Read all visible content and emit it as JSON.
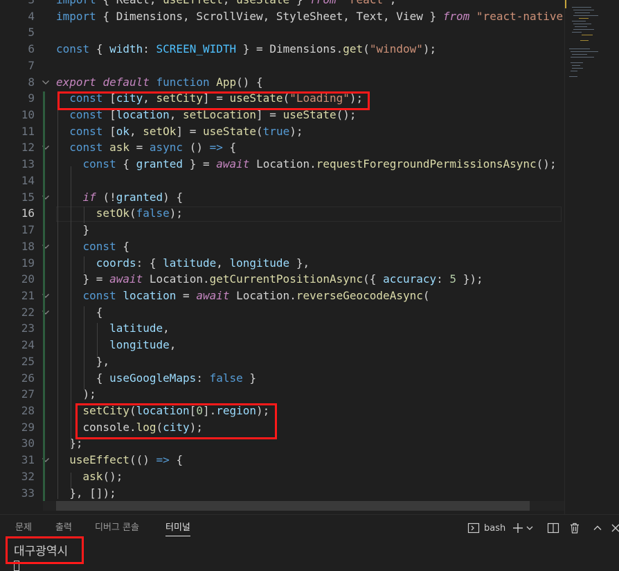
{
  "editor": {
    "line_numbers": [
      "3",
      "4",
      "5",
      "6",
      "7",
      "8",
      "9",
      "10",
      "11",
      "12",
      "13",
      "14",
      "15",
      "16",
      "17",
      "18",
      "19",
      "20",
      "21",
      "22",
      "23",
      "24",
      "25",
      "26",
      "27",
      "28",
      "29",
      "30",
      "31",
      "32",
      "33"
    ],
    "active_line": "16",
    "lines": {
      "l3": "import { React, useEffect, useState } from \"react\";",
      "l4": "import { Dimensions, ScrollView, StyleSheet, Text, View } from \"react-native\";",
      "l6": "const { width: SCREEN_WIDTH } = Dimensions.get(\"window\");",
      "l8": "export default function App() {",
      "l9": "  const [city, setCity] = useState(\"Loading\");",
      "l10": "  const [location, setLocation] = useState();",
      "l11": "  const [ok, setOk] = useState(true);",
      "l12": "  const ask = async () => {",
      "l13": "    const { granted } = await Location.requestForegroundPermissionsAsync();",
      "l15": "    if (!granted) {",
      "l16": "      setOk(false);",
      "l17": "    }",
      "l18": "    const {",
      "l19": "      coords: { latitude, longitude },",
      "l20": "    } = await Location.getCurrentPositionAsync({ accuracy: 5 });",
      "l21": "    const location = await Location.reverseGeocodeAsync(",
      "l22": "      {",
      "l23": "        latitude,",
      "l24": "        longitude,",
      "l25": "      },",
      "l26": "      { useGoogleMaps: false }",
      "l27": "    );",
      "l28": "    setCity(location[0].region);",
      "l29": "    console.log(city);",
      "l30": "  };",
      "l31": "  useEffect(() => {",
      "l32": "    ask();",
      "l33": "  }, []);"
    }
  },
  "panel": {
    "tabs": [
      "문제",
      "출력",
      "디버그 콘솔",
      "터미널"
    ],
    "active_tab": "터미널",
    "shell_label": "bash",
    "icons": [
      "terminal-icon",
      "plus-icon",
      "chevron-down-icon",
      "split-icon",
      "trash-icon",
      "chevron-up-icon",
      "close-icon"
    ]
  },
  "terminal": {
    "output": "대구광역시"
  },
  "colors": {
    "highlight_box": "#ff1a1a",
    "background": "#1f1f1f"
  }
}
